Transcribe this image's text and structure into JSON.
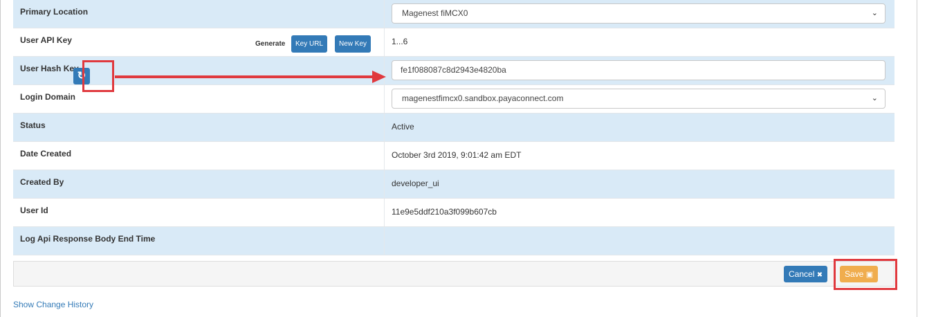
{
  "rows": [
    {
      "label": "Primary Location",
      "value": "Magenest fiMCX0",
      "type": "select"
    },
    {
      "label": "User API Key",
      "value": "1...6",
      "type": "text"
    },
    {
      "label": "User Hash Key",
      "value": "fe1f088087c8d2943e4820ba",
      "type": "input"
    },
    {
      "label": "Login Domain",
      "value": "magenestfimcx0.sandbox.payaconnect.com",
      "type": "select"
    },
    {
      "label": "Status",
      "value": "Active",
      "type": "text"
    },
    {
      "label": "Date Created",
      "value": "October 3rd 2019, 9:01:42 am EDT",
      "type": "text"
    },
    {
      "label": "Created By",
      "value": "developer_ui",
      "type": "text"
    },
    {
      "label": "User Id",
      "value": "11e9e5ddf210a3f099b607cb",
      "type": "text"
    },
    {
      "label": "Log Api Response Body End Time",
      "value": "",
      "type": "text"
    }
  ],
  "api_key": {
    "generate_label": "Generate",
    "key_url_label": "Key URL",
    "new_key_label": "New Key"
  },
  "hash_key": {
    "refresh_icon": "refresh-icon",
    "refresh_glyph": "↻"
  },
  "select": {
    "chevron_glyph": "⌄"
  },
  "footer": {
    "cancel_label": "Cancel",
    "cancel_icon_glyph": "✖",
    "save_label": "Save",
    "save_icon_glyph": "▣"
  },
  "links": {
    "change_history": "Show Change History"
  },
  "colors": {
    "primary": "#337ab7",
    "warning": "#f0ad4e",
    "highlight": "#e0393e",
    "row_alt": "#d9eaf7"
  }
}
